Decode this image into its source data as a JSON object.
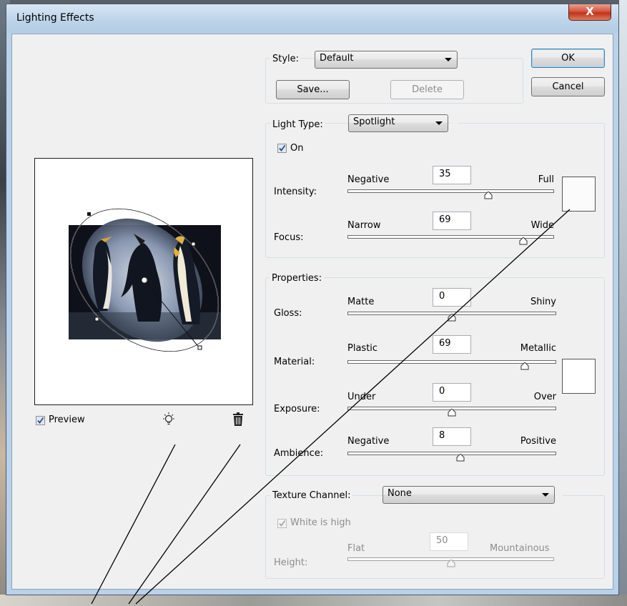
{
  "window": {
    "title": "Lighting Effects",
    "close_glyph": "X"
  },
  "style": {
    "label": "Style:",
    "value": "Default",
    "save_label": "Save...",
    "delete_label": "Delete"
  },
  "buttons": {
    "ok": "OK",
    "cancel": "Cancel"
  },
  "light_type": {
    "label": "Light Type:",
    "value": "Spotlight",
    "on_label": "On",
    "on_checked": true,
    "light_color": "#fbfbfb",
    "sliders": [
      {
        "key": "intensity",
        "label": "Intensity:",
        "left": "Negative",
        "right": "Full",
        "value": "35",
        "fraction": 0.68
      },
      {
        "key": "focus",
        "label": "Focus:",
        "left": "Narrow",
        "right": "Wide",
        "value": "69",
        "fraction": 0.85
      }
    ]
  },
  "properties": {
    "label": "Properties:",
    "ambient_color": "#ffffff",
    "sliders": [
      {
        "key": "gloss",
        "label": "Gloss:",
        "left": "Matte",
        "right": "Shiny",
        "value": "0",
        "fraction": 0.5
      },
      {
        "key": "material",
        "label": "Material:",
        "left": "Plastic",
        "right": "Metallic",
        "value": "69",
        "fraction": 0.85
      },
      {
        "key": "exposure",
        "label": "Exposure:",
        "left": "Under",
        "right": "Over",
        "value": "0",
        "fraction": 0.5
      },
      {
        "key": "ambience",
        "label": "Ambience:",
        "left": "Negative",
        "right": "Positive",
        "value": "8",
        "fraction": 0.54
      }
    ]
  },
  "texture": {
    "label": "Texture Channel:",
    "value": "None",
    "white_is_high_label": "White is high",
    "white_is_high_checked": true,
    "height_label": "Height:",
    "left": "Flat",
    "right": "Mountainous",
    "value_text": "50",
    "fraction": 0.5
  },
  "preview": {
    "label": "Preview",
    "checked": true,
    "new_light_icon": "lightbulb-icon",
    "delete_light_icon": "trash-icon"
  }
}
